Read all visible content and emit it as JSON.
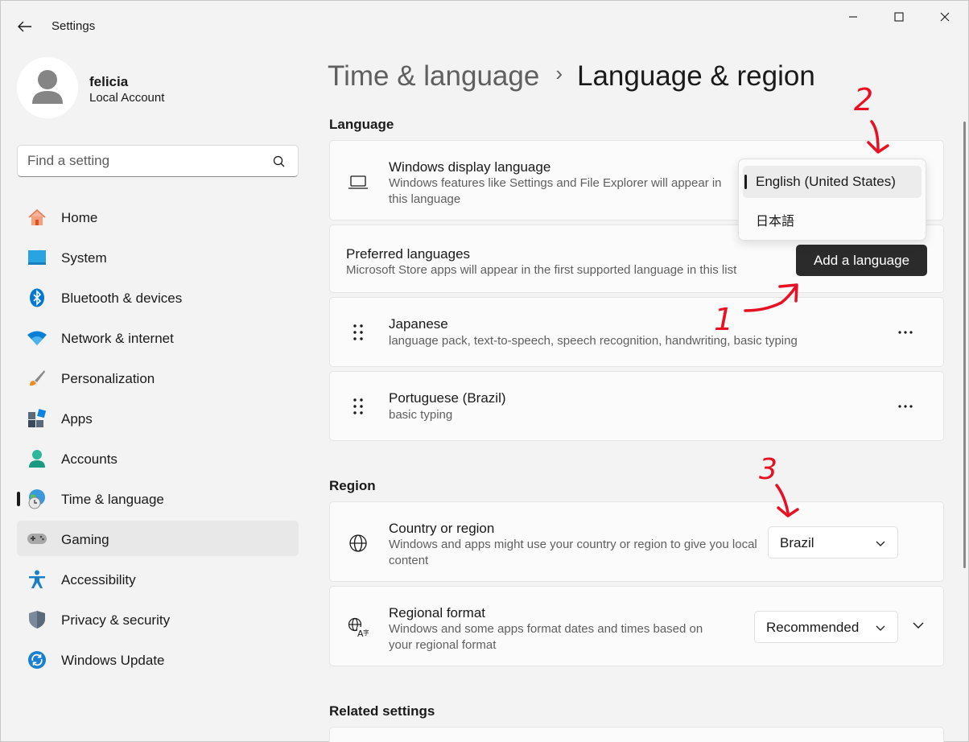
{
  "window": {
    "title": "Settings"
  },
  "profile": {
    "name": "felicia",
    "account_type": "Local Account"
  },
  "search": {
    "placeholder": "Find a setting"
  },
  "sidebar": {
    "items": [
      {
        "label": "Home",
        "icon": "home-icon"
      },
      {
        "label": "System",
        "icon": "system-icon"
      },
      {
        "label": "Bluetooth & devices",
        "icon": "bluetooth-icon"
      },
      {
        "label": "Network & internet",
        "icon": "wifi-icon"
      },
      {
        "label": "Personalization",
        "icon": "brush-icon"
      },
      {
        "label": "Apps",
        "icon": "apps-icon"
      },
      {
        "label": "Accounts",
        "icon": "accounts-icon"
      },
      {
        "label": "Time & language",
        "icon": "time-language-icon",
        "selected": true
      },
      {
        "label": "Gaming",
        "icon": "gaming-icon",
        "hovered": true
      },
      {
        "label": "Accessibility",
        "icon": "accessibility-icon"
      },
      {
        "label": "Privacy & security",
        "icon": "shield-icon"
      },
      {
        "label": "Windows Update",
        "icon": "update-icon"
      }
    ]
  },
  "breadcrumb": {
    "parent": "Time & language",
    "separator": "›",
    "current": "Language & region"
  },
  "language_section": {
    "title": "Language",
    "display_language": {
      "title": "Windows display language",
      "description": "Windows features like Settings and File Explorer will appear in this language"
    },
    "preferred": {
      "title": "Preferred languages",
      "description": "Microsoft Store apps will appear in the first supported language in this list",
      "add_button": "Add a language"
    },
    "languages": [
      {
        "name": "Japanese",
        "features": "language pack, text-to-speech, speech recognition, handwriting, basic typing"
      },
      {
        "name": "Portuguese (Brazil)",
        "features": "basic typing"
      }
    ]
  },
  "display_language_flyout": {
    "options": [
      "English (United States)",
      "日本語"
    ],
    "selected": "English (United States)"
  },
  "region_section": {
    "title": "Region",
    "country": {
      "title": "Country or region",
      "description": "Windows and apps might use your country or region to give you local content",
      "value": "Brazil"
    },
    "format": {
      "title": "Regional format",
      "description": "Windows and some apps format dates and times based on your regional format",
      "value": "Recommended"
    }
  },
  "related": {
    "title": "Related settings"
  },
  "annotations": {
    "one": "1",
    "two": "2",
    "three": "3",
    "color": "#e81123"
  },
  "colors": {
    "accent": "#0067c0",
    "background": "#f3f3f3",
    "button_dark": "#2b2b2b"
  }
}
